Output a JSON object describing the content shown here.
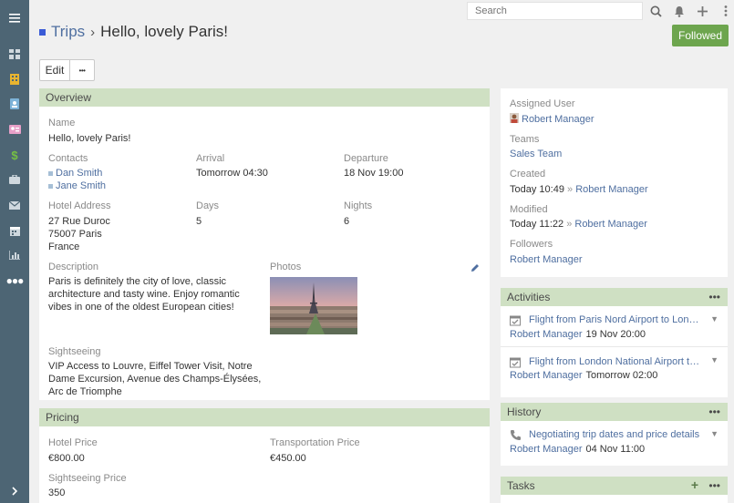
{
  "header": {
    "search_placeholder": "Search"
  },
  "title": {
    "crumb": "Trips",
    "separator": "›",
    "name": "Hello, lovely Paris!",
    "followed_label": "Followed"
  },
  "actions": {
    "edit_label": "Edit",
    "more_label": "•••"
  },
  "overview": {
    "heading": "Overview",
    "name_label": "Name",
    "name_value": "Hello, lovely Paris!",
    "contacts_label": "Contacts",
    "contacts": [
      "Dan Smith",
      "Jane Smith"
    ],
    "arrival_label": "Arrival",
    "arrival_value": "Tomorrow 04:30",
    "departure_label": "Departure",
    "departure_value": "18 Nov 19:00",
    "hotel_label": "Hotel Address",
    "hotel_lines": [
      "27 Rue Duroc",
      "75007 Paris",
      "France"
    ],
    "days_label": "Days",
    "days_value": "5",
    "nights_label": "Nights",
    "nights_value": "6",
    "description_label": "Description",
    "description_lines": [
      "Paris is definitely the city of love, classic",
      "architecture and tasty wine. Enjoy romantic",
      "vibes in one of the oldest European cities!"
    ],
    "photos_label": "Photos",
    "sightseeing_label": "Sightseeing",
    "sightseeing_lines": [
      "VIP Access to Louvre, Eiffel Tower Visit, Notre",
      "Dame Excursion, Avenue des Champs-Élysées,",
      "Arc de Triomphe"
    ]
  },
  "pricing": {
    "heading": "Pricing",
    "hotel_price_label": "Hotel Price",
    "hotel_price_value": "€800.00",
    "transport_label": "Transportation Price",
    "transport_value": "€450.00",
    "sightseeing_price_label": "Sightseeing Price",
    "sightseeing_price_value": "350"
  },
  "side": {
    "assigned_label": "Assigned User",
    "assigned_value": "Robert Manager",
    "teams_label": "Teams",
    "teams_value": "Sales Team",
    "created_label": "Created",
    "created_date": "Today 10:49",
    "created_sep": "»",
    "created_by": "Robert Manager",
    "modified_label": "Modified",
    "modified_date": "Today 11:22",
    "modified_sep": "»",
    "modified_by": "Robert Manager",
    "followers_label": "Followers",
    "followers_value": "Robert Manager"
  },
  "activities": {
    "heading": "Activities",
    "items": [
      {
        "title": "Flight from Paris Nord Airport to London",
        "user": "Robert Manager",
        "date": "19 Nov 20:00"
      },
      {
        "title": "Flight from London National Airport to Paris",
        "user": "Robert Manager",
        "date": "Tomorrow 02:00"
      }
    ]
  },
  "history": {
    "heading": "History",
    "items": [
      {
        "title": "Negotiating trip dates and price details",
        "user": "Robert Manager",
        "date": "04 Nov 11:00"
      }
    ]
  },
  "tasks": {
    "heading": "Tasks"
  },
  "colors": {
    "sidebar": "#4d6574",
    "panel_header": "#cfe0c3",
    "followed": "#6da54e",
    "link": "#4f6fa0"
  }
}
